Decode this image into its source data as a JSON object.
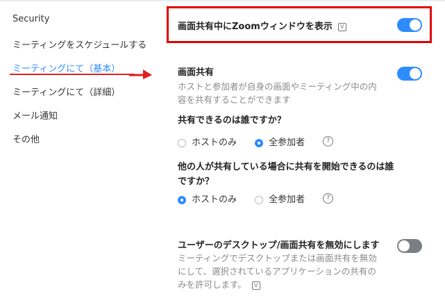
{
  "sidebar": {
    "items": [
      {
        "label": "Security"
      },
      {
        "label": "ミーティングをスケジュールする"
      },
      {
        "label": "ミーティングにて（基本）",
        "active": true
      },
      {
        "label": "ミーティングにて（詳細）"
      },
      {
        "label": "メール通知"
      },
      {
        "label": "その他"
      }
    ]
  },
  "settings": {
    "zoom_window": {
      "title": "画面共有中にZoomウィンドウを表示",
      "enabled": true
    },
    "screen_share": {
      "title": "画面共有",
      "desc_line1": "ホストと参加者が自身の画面やミーティング中の内",
      "desc_line2": "容を共有することができます",
      "enabled": true,
      "who_can_share": {
        "question": "共有できるのは誰ですか？",
        "options": [
          "ホストのみ",
          "全参加者"
        ],
        "selected": "全参加者"
      },
      "who_can_start": {
        "question_line1": "他の人が共有している場合に共有を開始できるのは誰",
        "question_line2": "ですか？",
        "options": [
          "ホストのみ",
          "全参加者"
        ],
        "selected": "ホストのみ"
      }
    },
    "disable_desktop_share": {
      "title": "ユーザーのデスクトップ/画面共有を無効にします",
      "desc_line1": "ミーティングでデスクトップまたは画面共有を無効",
      "desc_line2": "にして、選択されているアプリケーションの共有の",
      "desc_line3": "みを許可します。",
      "enabled": false
    }
  },
  "icons": {
    "help": "?",
    "verified": "V"
  },
  "colors": {
    "accent": "#2d8cff",
    "highlight": "#e00000",
    "toggle_off": "#7b7f85"
  }
}
